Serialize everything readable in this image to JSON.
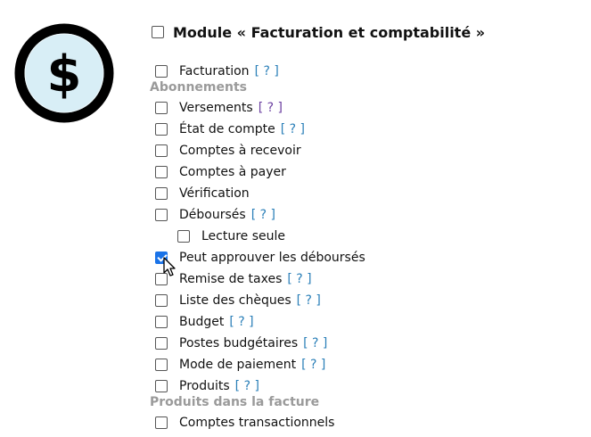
{
  "module": {
    "title": "Module « Facturation et comptabilité »",
    "checked": false
  },
  "logo": {
    "symbol": "$",
    "icon": "dollar-coin-icon",
    "ring_color": "#000000",
    "fill_color": "#d8eef6"
  },
  "colors": {
    "accent": "#1a73e8",
    "help_link": "#2a7fb8",
    "section": "#9a9a9a"
  },
  "items": [
    {
      "label": "Facturation",
      "help": "[ ? ]",
      "checked": false
    },
    {
      "section": "Abonnements"
    },
    {
      "label": "Versements",
      "help": "[ ? ]",
      "checked": false
    },
    {
      "label": "État de compte",
      "help": "[ ? ]",
      "checked": false
    },
    {
      "label": "Comptes à recevoir",
      "checked": false
    },
    {
      "label": "Comptes à payer",
      "checked": false
    },
    {
      "label": "Vérification",
      "checked": false
    },
    {
      "label": "Déboursés",
      "help": "[ ? ]",
      "checked": false
    },
    {
      "label": "Lecture seule",
      "checked": false,
      "indent": 1
    },
    {
      "label": "Peut approuver les déboursés",
      "checked": true
    },
    {
      "label": "Remise de taxes",
      "help": "[ ? ]",
      "checked": false
    },
    {
      "label": "Liste des chèques",
      "help": "[ ? ]",
      "checked": false
    },
    {
      "label": "Budget",
      "help": "[ ? ]",
      "checked": false
    },
    {
      "label": "Postes budgétaires",
      "help": "[ ? ]",
      "checked": false
    },
    {
      "label": "Mode de paiement",
      "help": "[ ? ]",
      "checked": false
    },
    {
      "label": "Produits",
      "help": "[ ? ]",
      "checked": false
    },
    {
      "section": "Produits dans la facture"
    },
    {
      "label": "Comptes transactionnels",
      "checked": false
    }
  ]
}
